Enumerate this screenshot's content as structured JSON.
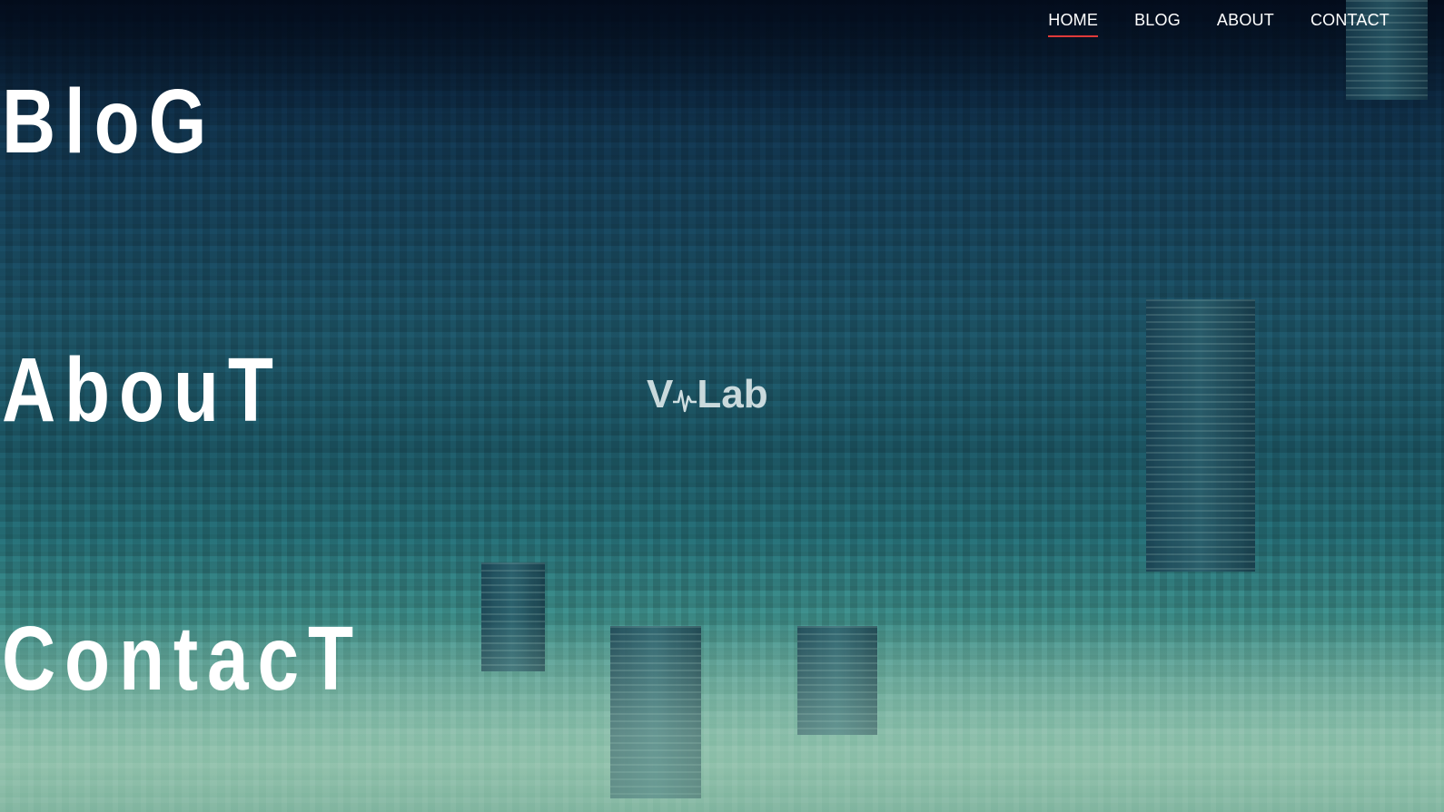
{
  "nav": {
    "items": [
      {
        "label": "HOME",
        "active": true
      },
      {
        "label": "BLOG",
        "active": false
      },
      {
        "label": "ABOUT",
        "active": false
      },
      {
        "label": "CONTACT",
        "active": false
      }
    ]
  },
  "hero": {
    "links": [
      {
        "label": "BloG"
      },
      {
        "label": "AbouT"
      },
      {
        "label": "ContacT"
      }
    ]
  },
  "logo": {
    "letter": "V",
    "text": "Lab",
    "icon": "heartbeat-icon"
  },
  "colors": {
    "accent": "#e03a3a",
    "text": "#ffffff",
    "background_tint": "#1d5466"
  }
}
